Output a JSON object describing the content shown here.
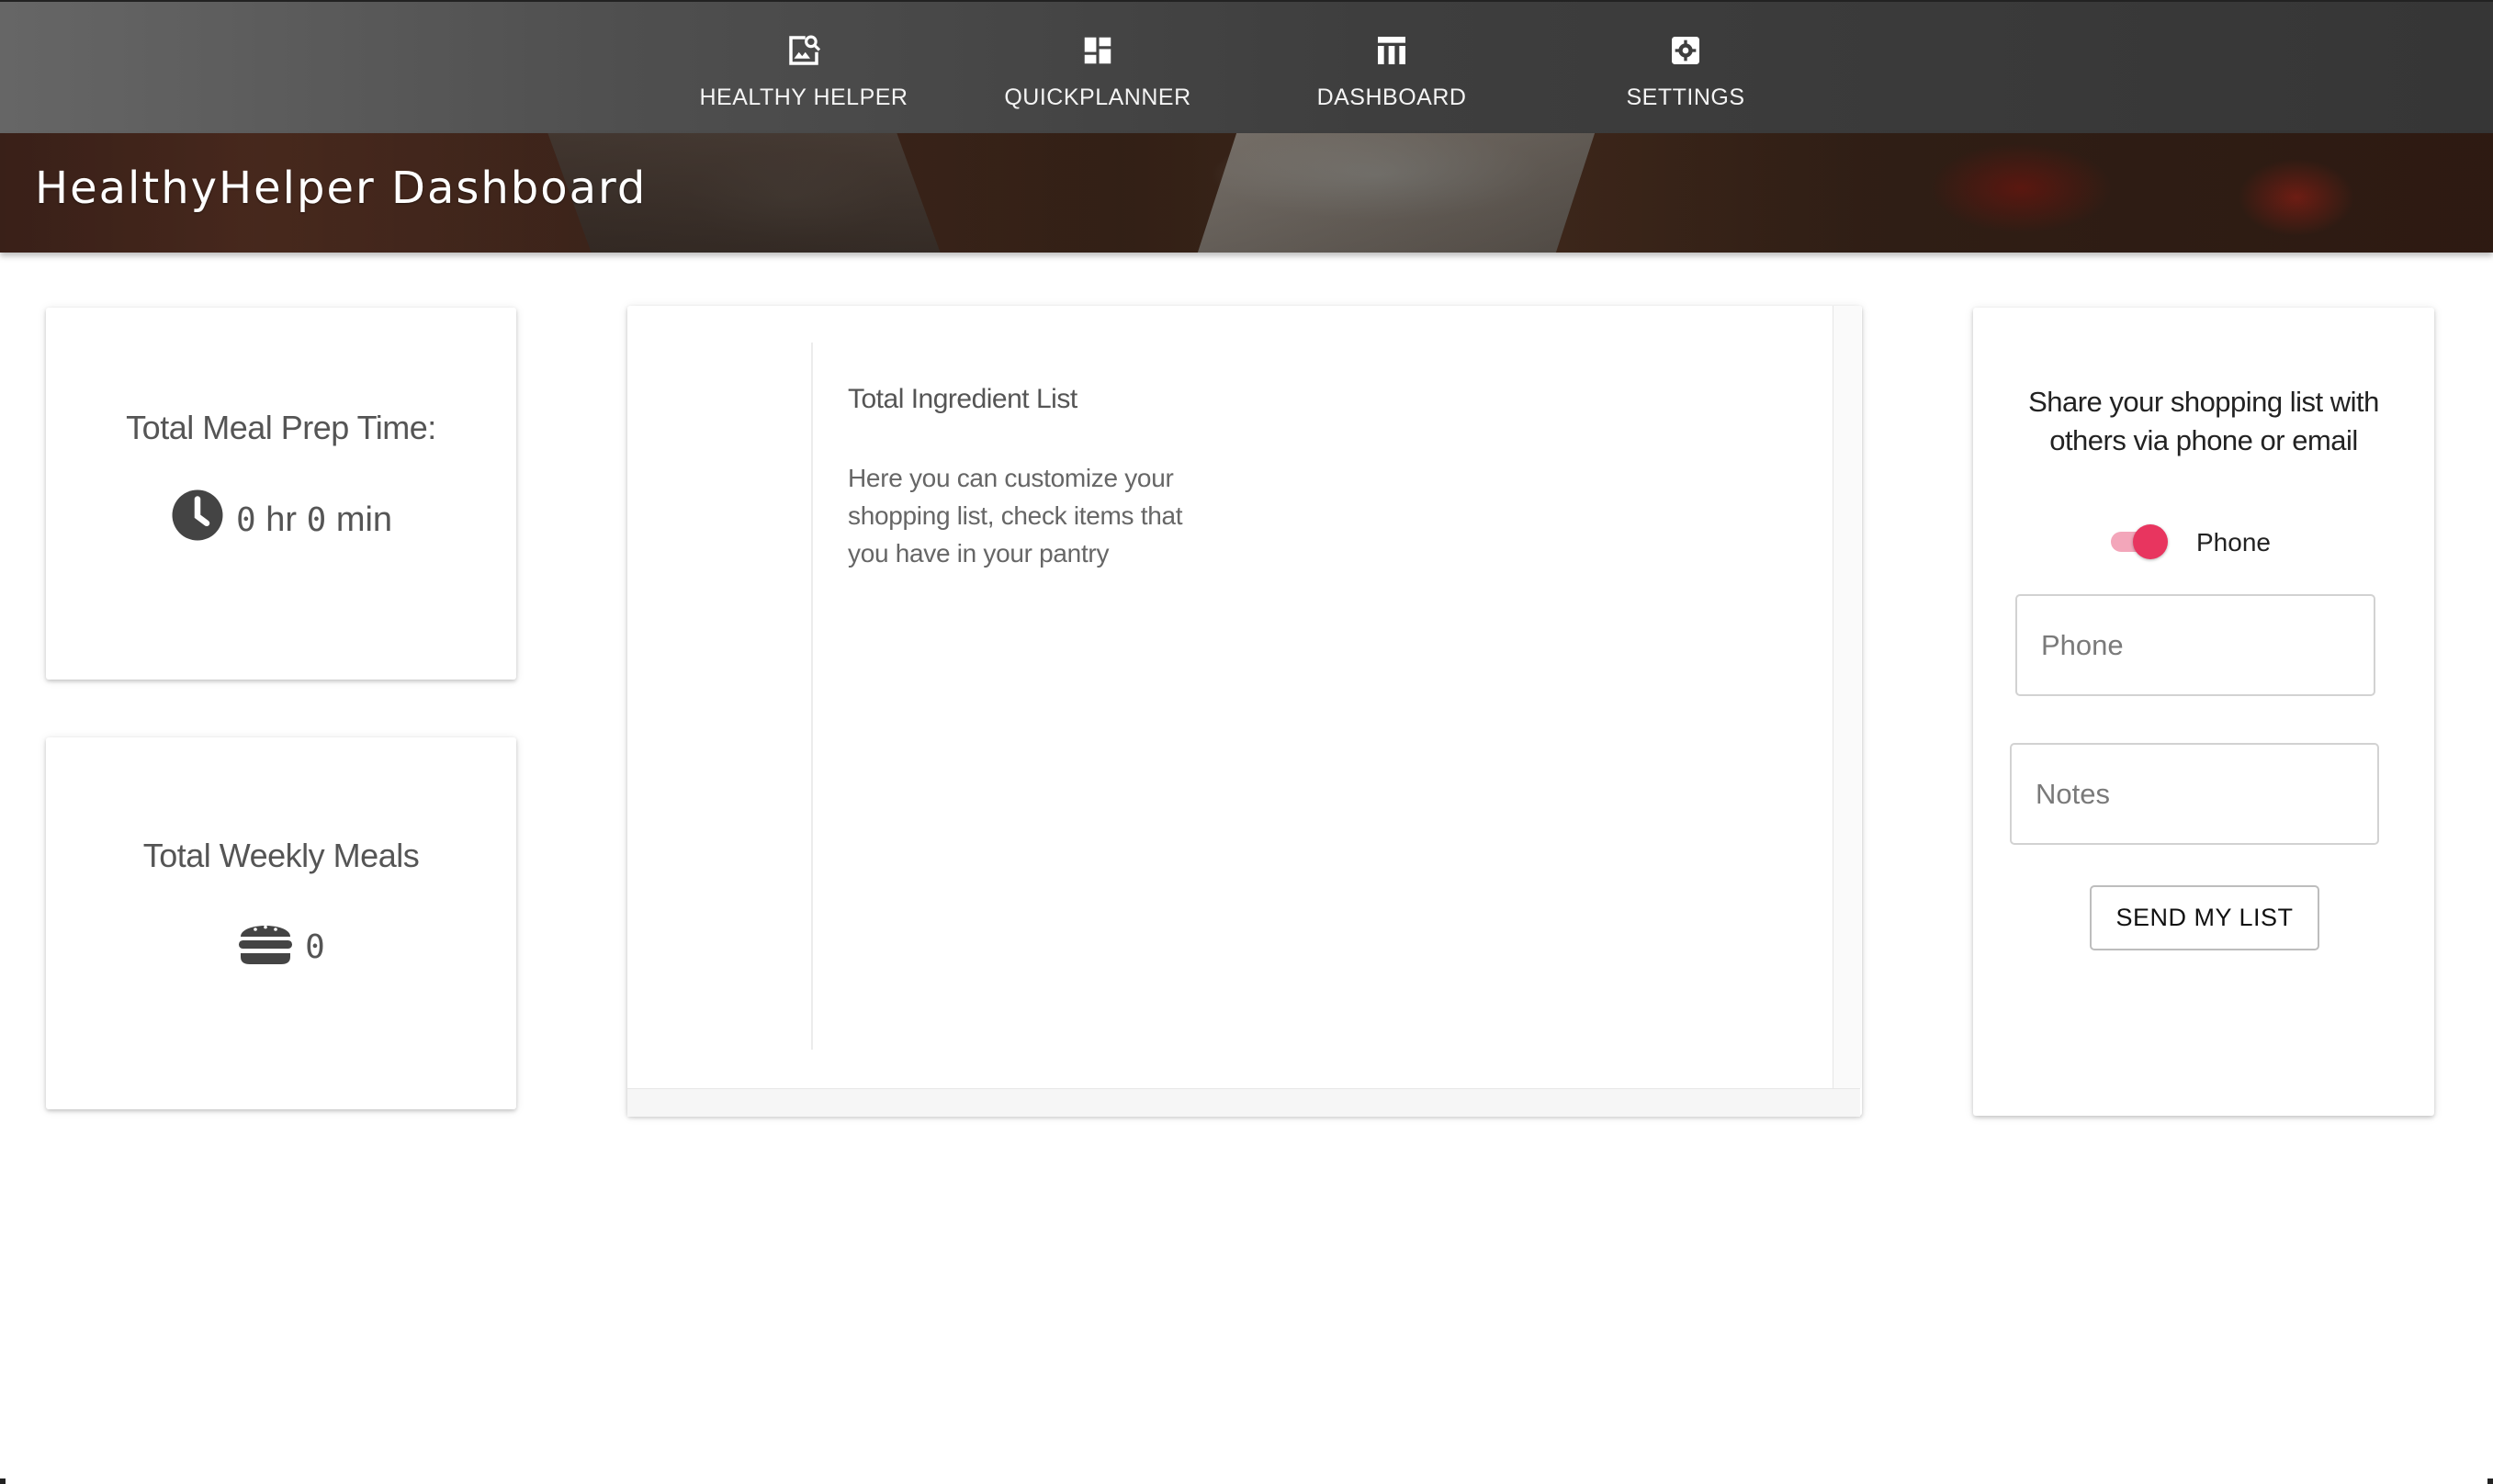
{
  "nav": {
    "items": [
      {
        "label": "HEALTHY HELPER",
        "icon": "image-search-icon"
      },
      {
        "label": "QUICKPLANNER",
        "icon": "dashboard-grid-icon"
      },
      {
        "label": "DASHBOARD",
        "icon": "table-chart-icon"
      },
      {
        "label": "SETTINGS",
        "icon": "gear-icon"
      }
    ]
  },
  "banner": {
    "title": "HealthyHelper Dashboard"
  },
  "prep_time": {
    "title": "Total Meal Prep Time:",
    "hours": "0",
    "hr_unit": "hr",
    "minutes": "0",
    "min_unit": "min",
    "icon": "clock-icon"
  },
  "weekly_meals": {
    "title": "Total Weekly Meals",
    "count": "0",
    "icon": "hamburger-icon"
  },
  "ingredients": {
    "title": "Total Ingredient List",
    "description": "Here you can customize your shopping list, check items that you have in your pantry"
  },
  "share": {
    "text": "Share your shopping list with others via phone or email",
    "toggle_label": "Phone",
    "toggle_on": true,
    "phone_placeholder": "Phone",
    "notes_placeholder": "Notes",
    "send_label": "SEND MY LIST"
  },
  "colors": {
    "accent": "#e8355f",
    "nav_bg": "#3e3e3e"
  }
}
